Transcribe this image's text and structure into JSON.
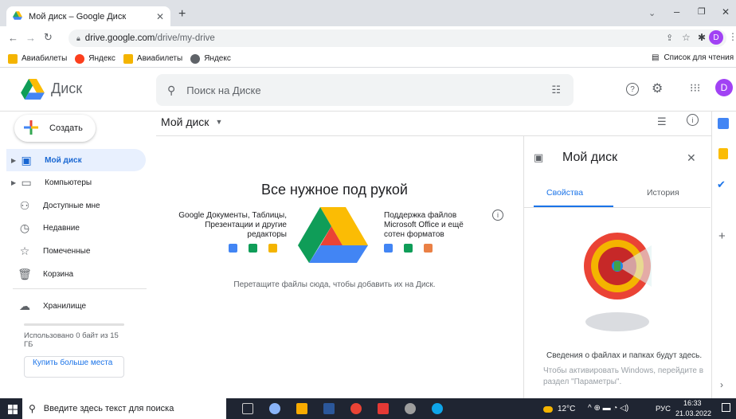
{
  "browser": {
    "tab_title": "Мой диск – Google Диск",
    "url_domain": "drive.google.com",
    "url_path": "/drive/my-drive",
    "profile_initial": "D",
    "bookmarks": [
      {
        "label": "Авиабилеты",
        "color": "#f4b400"
      },
      {
        "label": "Яндекс",
        "color": "#fc3f1d"
      },
      {
        "label": "Авиабилеты",
        "color": "#f4b400"
      },
      {
        "label": "Яндекс",
        "color": "#5f6368"
      }
    ],
    "reading_list": "Список для чтения"
  },
  "header": {
    "app_name": "Диск",
    "search_placeholder": "Поиск на Диске",
    "avatar_initial": "D"
  },
  "sidebar": {
    "create_label": "Создать",
    "items": [
      {
        "label": "Мой диск",
        "icon": "drive-icon"
      },
      {
        "label": "Компьютеры",
        "icon": "computer-icon"
      },
      {
        "label": "Доступные мне",
        "icon": "people-icon"
      },
      {
        "label": "Недавние",
        "icon": "clock-icon"
      },
      {
        "label": "Помеченные",
        "icon": "star-icon"
      },
      {
        "label": "Корзина",
        "icon": "trash-icon"
      }
    ],
    "storage_label": "Хранилище",
    "storage_usage": "Использовано 0 байт из 15 ГБ",
    "buy_more": "Купить больше места"
  },
  "main": {
    "breadcrumb": "Мой диск",
    "hero_title": "Все нужное под рукой",
    "left_feature": "Google Документы, Таблицы, Презентации и другие редакторы",
    "right_feature": "Поддержка файлов Microsoft Office и ещё сотен форматов",
    "drop_hint": "Перетащите файлы сюда, чтобы добавить их на Диск."
  },
  "details_panel": {
    "title": "Мой диск",
    "tabs": [
      "Свойства",
      "История"
    ],
    "empty_text": "Сведения о файлах и папках будут здесь.",
    "activation_line1": "Чтобы активировать Windows, перейдите в",
    "activation_line2": "раздел \"Параметры\"."
  },
  "taskbar": {
    "search_placeholder": "Введите здесь текст для поиска",
    "temperature": "12°C",
    "language": "РУС",
    "time": "16:33",
    "date": "21.03.2022"
  },
  "colors": {
    "accent": "#1a73e8",
    "active_bg": "#e8f0fe",
    "taskbar": "#1f2532"
  }
}
